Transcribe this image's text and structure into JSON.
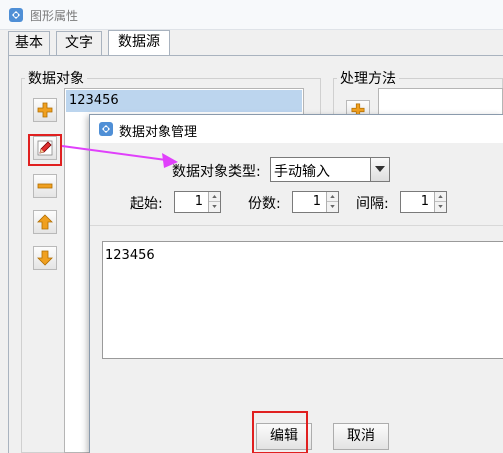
{
  "outer_window": {
    "title": "图形属性",
    "tabs": [
      {
        "label": "基本",
        "active": false
      },
      {
        "label": "文字",
        "active": false
      },
      {
        "label": "数据源",
        "active": true
      }
    ],
    "data_object_group_label": "数据对象",
    "processing_group_label": "处理方法",
    "data_object_list": [
      "123456"
    ]
  },
  "dialog": {
    "title": "数据对象管理",
    "type_label": "数据对象类型:",
    "type_value": "手动输入",
    "start_label": "起始:",
    "start_value": "1",
    "copies_label": "份数:",
    "copies_value": "1",
    "interval_label": "间隔:",
    "interval_value": "1",
    "content": "123456",
    "edit_button": "编辑",
    "cancel_button": "取消"
  },
  "colors": {
    "highlight_red": "#e02020",
    "arrow_magenta": "#e040fb",
    "selection_blue": "#bcd5ee",
    "icon_orange": "#f0a020"
  },
  "icons": [
    "app-icon",
    "add-icon",
    "edit-icon",
    "remove-icon",
    "move-up-icon",
    "move-down-icon",
    "dropdown-arrow-icon"
  ]
}
